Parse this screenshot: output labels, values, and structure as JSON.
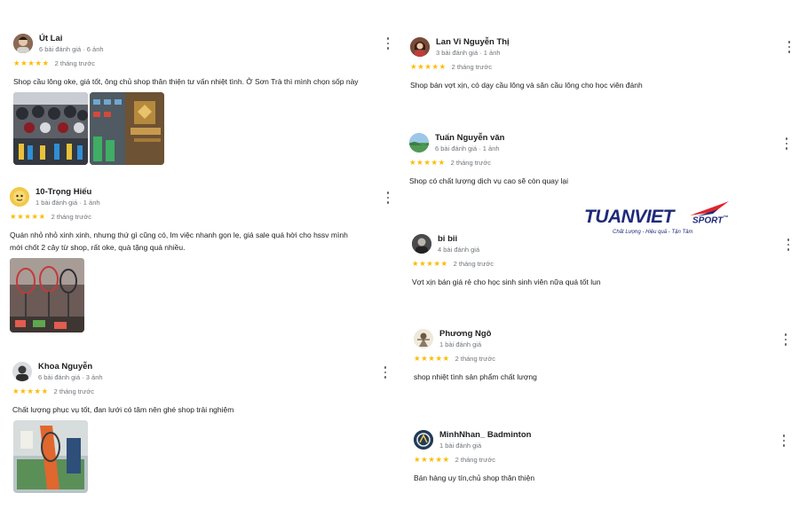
{
  "reviews": [
    {
      "name": "Út Lai",
      "meta": "6 bài đánh giá · 6 ảnh",
      "stars": "★★★★★",
      "time": "2 tháng trước",
      "text": [
        "Shop cầu lông oke, giá tốt, ông chủ shop thân thiện tư vấn nhiệt tình. Ở Sơn Trà thì mình chọn sốp này"
      ]
    },
    {
      "name": "10-Trọng Hiếu",
      "meta": "1 bài đánh giá · 1 ảnh",
      "stars": "★★★★★",
      "time": "2 tháng trước",
      "text": [
        "Quán nhỏ nhỏ xinh xinh, nhưng thứ gì cũng có, lm việc nhanh gọn lẹ, giá sale quá hời cho hssv mình",
        "mới chốt 2 cây từ shop, rất oke, quà tặng quá nhiều."
      ]
    },
    {
      "name": "Khoa Nguyễn",
      "meta": "6 bài đánh giá · 3 ảnh",
      "stars": "★★★★★",
      "time": "2 tháng trước",
      "text": [
        "Chất lượng phục vụ tốt, đan lưới có tâm nên ghé shop trải nghiệm"
      ]
    },
    {
      "name": "Lan Vi Nguyễn Thị",
      "meta": "3 bài đánh giá · 1 ảnh",
      "stars": "★★★★★",
      "time": "2 tháng trước",
      "text": [
        "Shop bán vợt xịn, có dạy cầu lông và sân cầu lông cho học viên đánh"
      ]
    },
    {
      "name": "Tuấn Nguyễn văn",
      "meta": "6 bài đánh giá · 1 ảnh",
      "stars": "★★★★★",
      "time": "2 tháng trước",
      "text": [
        "Shop có chất lượng dịch vụ cao sẽ còn quay lại"
      ]
    },
    {
      "name": "bi bii",
      "meta": "4 bài đánh giá",
      "stars": "★★★★★",
      "time": "2 tháng trước",
      "text": [
        "Vợt xịn bán giá rẻ cho học sinh sinh viên nữa quá tốt lun"
      ]
    },
    {
      "name": "Phương Ngô",
      "meta": "1 bài đánh giá",
      "stars": "★★★★★",
      "time": "2 tháng trước",
      "text": [
        "shop nhiệt tình sản phẩm chất lượng"
      ]
    },
    {
      "name": "MinhNhan_ Badminton",
      "meta": "1 bài đánh giá",
      "stars": "★★★★★",
      "time": "2 tháng trước",
      "text": [
        "Bán hàng uy tín,chủ shop thân thiện"
      ]
    }
  ],
  "logo": {
    "main": "TUANVIET",
    "sport": "SPORT",
    "tm": "™",
    "tagline": "Chất Lượng - Hiệu quả - Tận Tâm"
  },
  "colors": {
    "star": "#fbbc04",
    "logo_blue": "#1e2a78",
    "logo_red": "#e0242b",
    "meta_gray": "#70757a"
  }
}
